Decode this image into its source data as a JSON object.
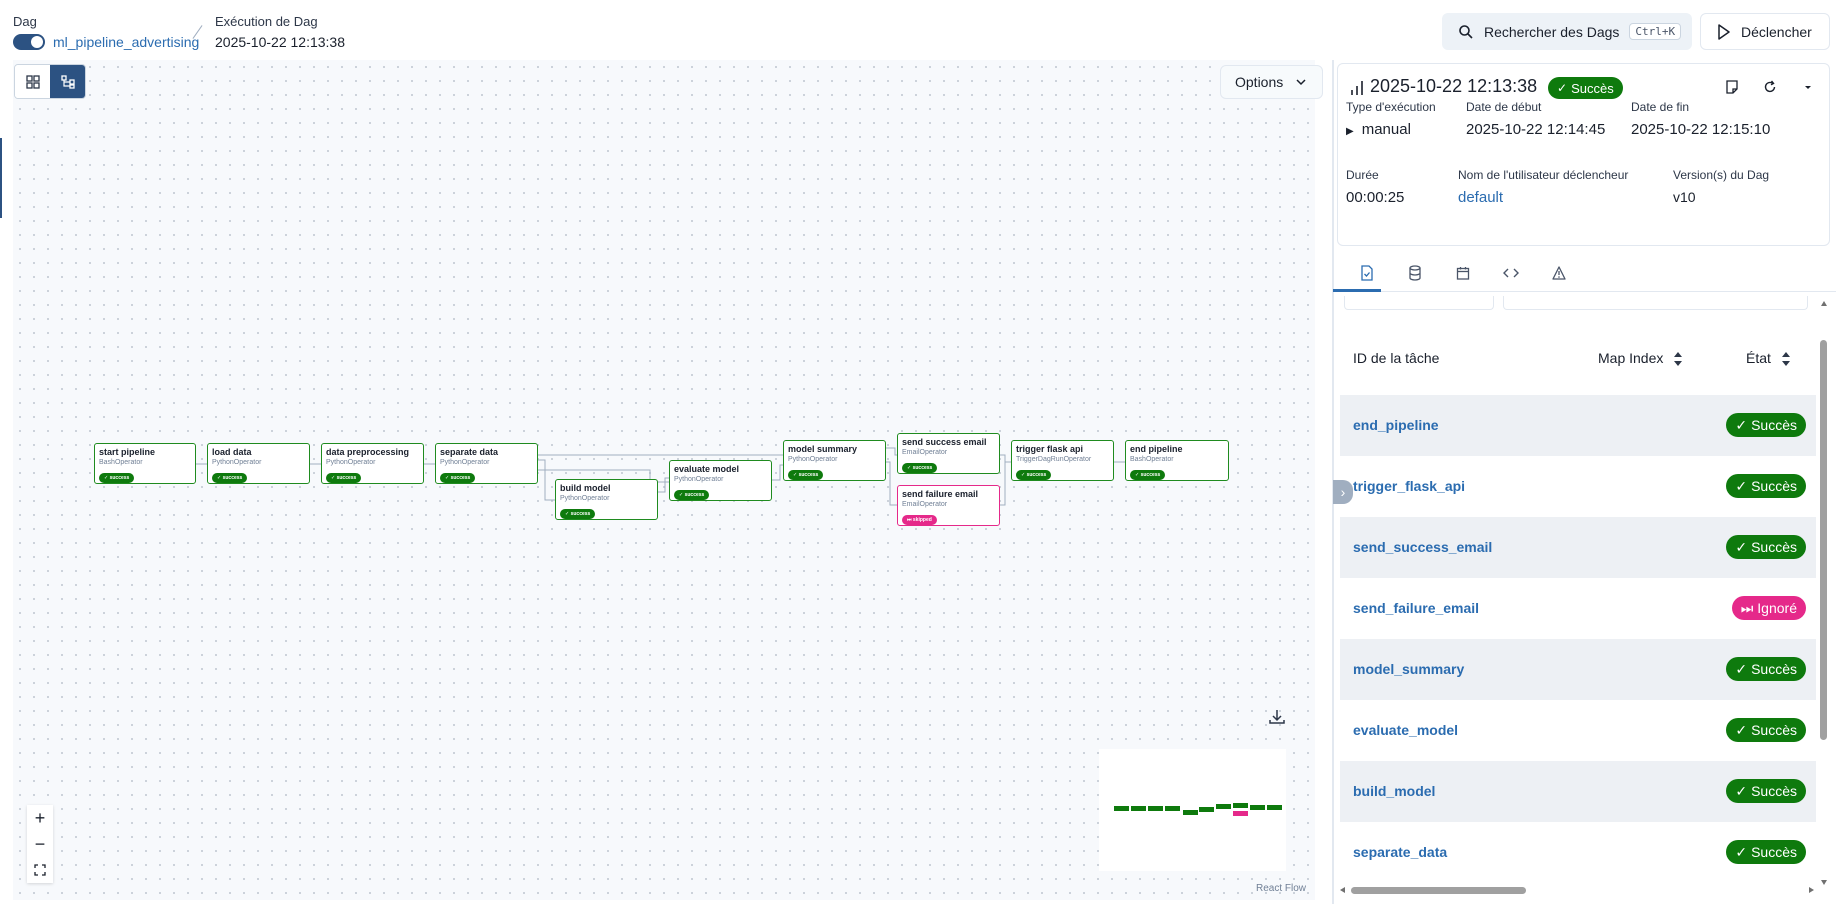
{
  "header": {
    "dag_label": "Dag",
    "dag_id": "ml_pipeline_advertising",
    "run_label": "Exécution de Dag",
    "run_value": "2025-10-22 12:13:38",
    "search_label": "Rechercher des Dags",
    "search_shortcut": "Ctrl+K",
    "trigger_label": "Déclencher"
  },
  "canvas": {
    "options_label": "Options",
    "attribution": "React Flow",
    "nodes": [
      {
        "title": "start pipeline",
        "operator": "BashOperator",
        "state": "success"
      },
      {
        "title": "load data",
        "operator": "PythonOperator",
        "state": "success"
      },
      {
        "title": "data preprocessing",
        "operator": "PythonOperator",
        "state": "success"
      },
      {
        "title": "separate data",
        "operator": "PythonOperator",
        "state": "success"
      },
      {
        "title": "build model",
        "operator": "PythonOperator",
        "state": "success"
      },
      {
        "title": "evaluate model",
        "operator": "PythonOperator",
        "state": "success"
      },
      {
        "title": "model summary",
        "operator": "PythonOperator",
        "state": "success"
      },
      {
        "title": "send success email",
        "operator": "EmailOperator",
        "state": "success"
      },
      {
        "title": "send failure email",
        "operator": "EmailOperator",
        "state": "skipped"
      },
      {
        "title": "trigger flask api",
        "operator": "TriggerDagRunOperator",
        "state": "success"
      },
      {
        "title": "end pipeline",
        "operator": "BashOperator",
        "state": "success"
      }
    ]
  },
  "run_card": {
    "title": "2025-10-22 12:13:38",
    "status": "Succès",
    "run_type_label": "Type d'exécution",
    "run_type_value": "manual",
    "start_label": "Date de début",
    "start_value": "2025-10-22 12:14:45",
    "end_label": "Date de fin",
    "end_value": "2025-10-22 12:15:10",
    "duration_label": "Durée",
    "duration_value": "00:00:25",
    "user_label": "Nom de l'utilisateur déclencheur",
    "user_value": "default",
    "version_label": "Version(s) du Dag",
    "version_value": "v10"
  },
  "table": {
    "col_task": "ID de la tâche",
    "col_map": "Map Index",
    "col_state": "État",
    "rows": [
      {
        "task_id": "end_pipeline",
        "state": "Succès",
        "kind": "ok"
      },
      {
        "task_id": "trigger_flask_api",
        "state": "Succès",
        "kind": "ok"
      },
      {
        "task_id": "send_success_email",
        "state": "Succès",
        "kind": "ok"
      },
      {
        "task_id": "send_failure_email",
        "state": "Ignoré",
        "kind": "skip"
      },
      {
        "task_id": "model_summary",
        "state": "Succès",
        "kind": "ok"
      },
      {
        "task_id": "evaluate_model",
        "state": "Succès",
        "kind": "ok"
      },
      {
        "task_id": "build_model",
        "state": "Succès",
        "kind": "ok"
      },
      {
        "task_id": "separate_data",
        "state": "Succès",
        "kind": "ok"
      }
    ]
  },
  "colors": {
    "success": "#0e7a0d",
    "skipped": "#e5298a",
    "link": "#2b6cb0",
    "accent": "#2c5282"
  }
}
